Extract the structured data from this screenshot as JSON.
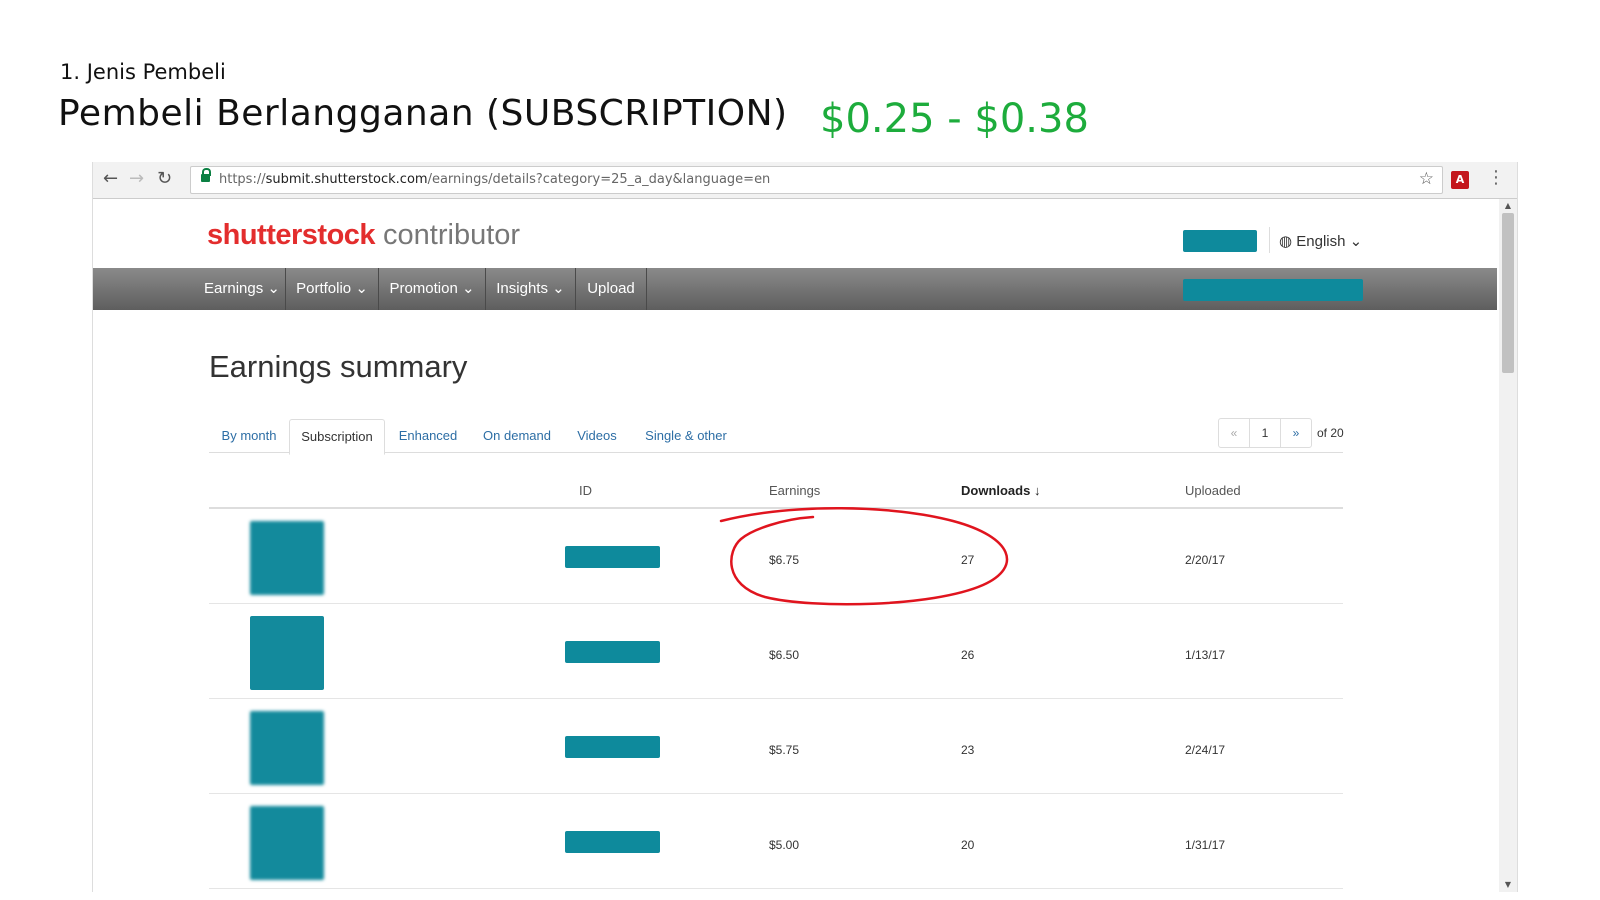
{
  "slide": {
    "subtitle": "1. Jenis Pembeli",
    "title": "Pembeli Berlangganan (SUBSCRIPTION)",
    "price_range": "$0.25 - $0.38"
  },
  "browser": {
    "url_scheme": "https://",
    "url_host": "submit.shutterstock.com",
    "url_path": "/earnings/details?category=25_a_day&language=en",
    "extension_label": "A"
  },
  "header": {
    "brand": "shutterstock",
    "brand_sub": "contributor",
    "language": "English"
  },
  "nav": {
    "items": [
      {
        "label": "Earnings"
      },
      {
        "label": "Portfolio"
      },
      {
        "label": "Promotion"
      },
      {
        "label": "Insights"
      },
      {
        "label": "Upload"
      }
    ]
  },
  "main": {
    "heading": "Earnings summary",
    "tabs": [
      {
        "label": "By month"
      },
      {
        "label": "Subscription",
        "active": true
      },
      {
        "label": "Enhanced"
      },
      {
        "label": "On demand"
      },
      {
        "label": "Videos"
      },
      {
        "label": "Single & other"
      }
    ],
    "pager": {
      "prev": "«",
      "current": "1",
      "next": "»",
      "of_total": "of 20"
    },
    "table": {
      "columns": [
        "ID",
        "Earnings",
        "Downloads",
        "Uploaded"
      ],
      "sort_indicator": "↓",
      "rows": [
        {
          "earnings": "$6.75",
          "downloads": "27",
          "uploaded": "2/20/17"
        },
        {
          "earnings": "$6.50",
          "downloads": "26",
          "uploaded": "1/13/17"
        },
        {
          "earnings": "$5.75",
          "downloads": "23",
          "uploaded": "2/24/17"
        },
        {
          "earnings": "$5.00",
          "downloads": "20",
          "uploaded": "1/31/17"
        }
      ]
    }
  },
  "colors": {
    "brand_red": "#e32d2d",
    "price_green": "#1dac3c",
    "redaction_teal": "#0e8a9c",
    "annotation_red": "#e0141e",
    "link_blue": "#2d6ea5"
  }
}
